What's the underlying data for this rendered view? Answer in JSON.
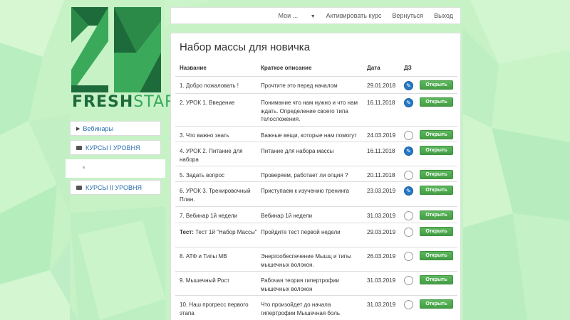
{
  "brand": {
    "logo_text": "23",
    "part1": "FRESH",
    "part2": "START"
  },
  "sidebar": {
    "items": [
      {
        "label": "Вебинары",
        "icon": "triangle-right-icon"
      },
      {
        "label": "КУРСЫ I УРОВНЯ",
        "icon": "folder-icon"
      },
      {
        "label": "КУРСЫ II УРОВНЯ",
        "icon": "folder-icon"
      }
    ]
  },
  "topnav": {
    "my": "Мои ...",
    "activate": "Активировать курс",
    "back": "Вернуться",
    "logout": "Выход"
  },
  "main": {
    "title": "Набор массы для новичка",
    "headers": {
      "name": "Название",
      "desc": "Краткое описание",
      "date": "Дата",
      "dz": "ДЗ"
    },
    "open_label": "Открыть",
    "rows": [
      {
        "prefix": "",
        "name": "1. Добро пожаловать !",
        "desc": "Прочтите это перед началом",
        "date": "29.01.2018",
        "dz": true
      },
      {
        "prefix": "",
        "name": "2. УРОК 1. Введение",
        "desc": "Понимание что нам нужно и что нам ждать. Определение своего типа телосложения.",
        "date": "16.11.2018",
        "dz": true
      },
      {
        "prefix": "",
        "name": "3. Что важно знать",
        "desc": "Важные вещи, которые нам помогут",
        "date": "24.03.2019",
        "dz": false
      },
      {
        "prefix": "",
        "name": "4. УРОК 2. Питание для набора",
        "desc": "Питание для набора массы",
        "date": "16.11.2018",
        "dz": true
      },
      {
        "prefix": "",
        "name": "5. Задать вопрос",
        "desc": "Проверяем, работает ли опция ?",
        "date": "20.11.2018",
        "dz": false
      },
      {
        "prefix": "",
        "name": "6. УРОК 3. Тренировочный План.",
        "desc": "Приступаем к изучению тренинга",
        "date": "23.03.2019",
        "dz": true
      },
      {
        "prefix": "",
        "name": "7. Вебинар 1й недели",
        "desc": "Вебинар 1й недели",
        "date": "31.03.2019",
        "dz": false
      },
      {
        "prefix": "Тест:",
        "name": "Тест 1й \"Набор Массы\"",
        "desc": "Пройдите тест первой недели",
        "date": "29.03.2019",
        "dz": false
      },
      {
        "prefix": "",
        "name": "8. АТФ и Типы МВ",
        "desc": "Энергообеспечение Мышц и типы мышечных волокон.",
        "date": "26.03.2019",
        "dz": false
      },
      {
        "prefix": "",
        "name": "9. Мышечный Рост",
        "desc": "Рабочая теория гипертрофии мышечных волокон",
        "date": "31.03.2019",
        "dz": false
      },
      {
        "prefix": "",
        "name": "10. Наш прогресс первого этапа",
        "desc": "Что произойдет до начала гипертрофии Мышечная боль",
        "date": "31.03.2019",
        "dz": false
      }
    ]
  },
  "colors": {
    "accent_green": "#5cb85c",
    "dz_blue": "#2478c6",
    "brand_dark": "#1d6b3a"
  }
}
